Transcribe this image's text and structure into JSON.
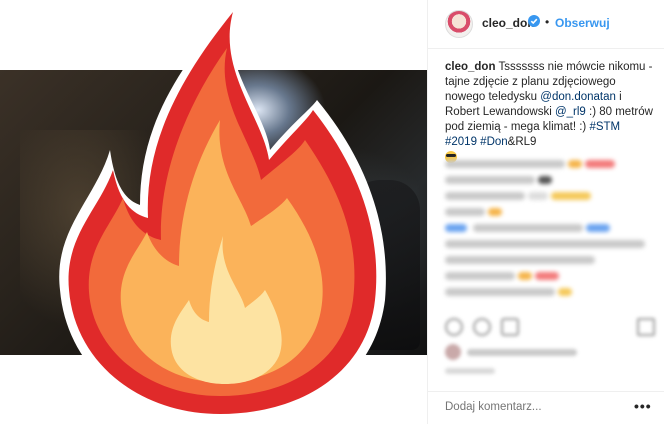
{
  "post": {
    "username": "cleo_don",
    "follow_label": "Obserwuj",
    "separator": "•",
    "verified_icon": "verified-badge-icon",
    "caption": {
      "username": "cleo_don",
      "text_1": " Tsssssss nie mówcie nikomu - tajne zdjęcie z planu zdjęciowego nowego teledysku ",
      "mention_1": "@don.donatan",
      "text_2": " i Robert Lewandowski ",
      "mention_2": "@_rl9",
      "text_3": " :) 80 metrów pod ziemią - mega klimat! :) ",
      "tags": "#STM #2019 #Don",
      "text_4": "&RL9",
      "emoji": "sunglasses-emoji"
    },
    "comment_placeholder": "Dodaj komentarz...",
    "more_label": "•••"
  },
  "colors": {
    "accent": "#3897f0",
    "link": "#003569",
    "text": "#262626",
    "fire_outer": "#e02a2a",
    "fire_mid": "#f26a3b",
    "fire_inner": "#fbb35a",
    "fire_core": "#fde3a2"
  },
  "overlay": {
    "icon": "fire-emoji-icon"
  }
}
